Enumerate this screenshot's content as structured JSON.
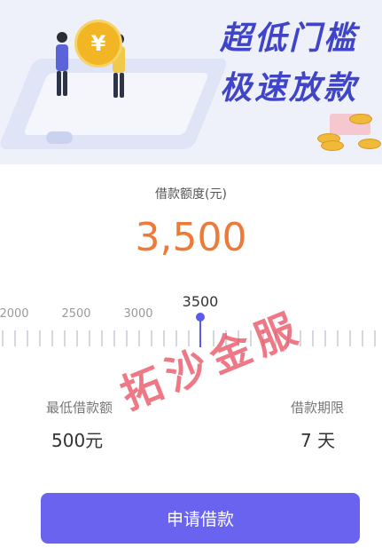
{
  "banner": {
    "slogan_line1": "超低门槛",
    "slogan_line2": "极速放款",
    "coin_symbol": "¥",
    "accent_color": "#3f44c8"
  },
  "amount": {
    "label": "借款额度(元)",
    "value": "3,500",
    "color": "#ee7a3a"
  },
  "slider": {
    "min_visible": 2000,
    "current": 3500,
    "current_label": "3500",
    "tick_labels": [
      "2000",
      "2500",
      "3000"
    ],
    "color": "#5b5bea"
  },
  "info": {
    "min_amount_label": "最低借款额",
    "min_amount_value": "500元",
    "term_label": "借款期限",
    "term_value": "7 天"
  },
  "apply_button": {
    "label": "申请借款",
    "color": "#6a63ef"
  },
  "watermark": {
    "text": "拓沙金服"
  }
}
